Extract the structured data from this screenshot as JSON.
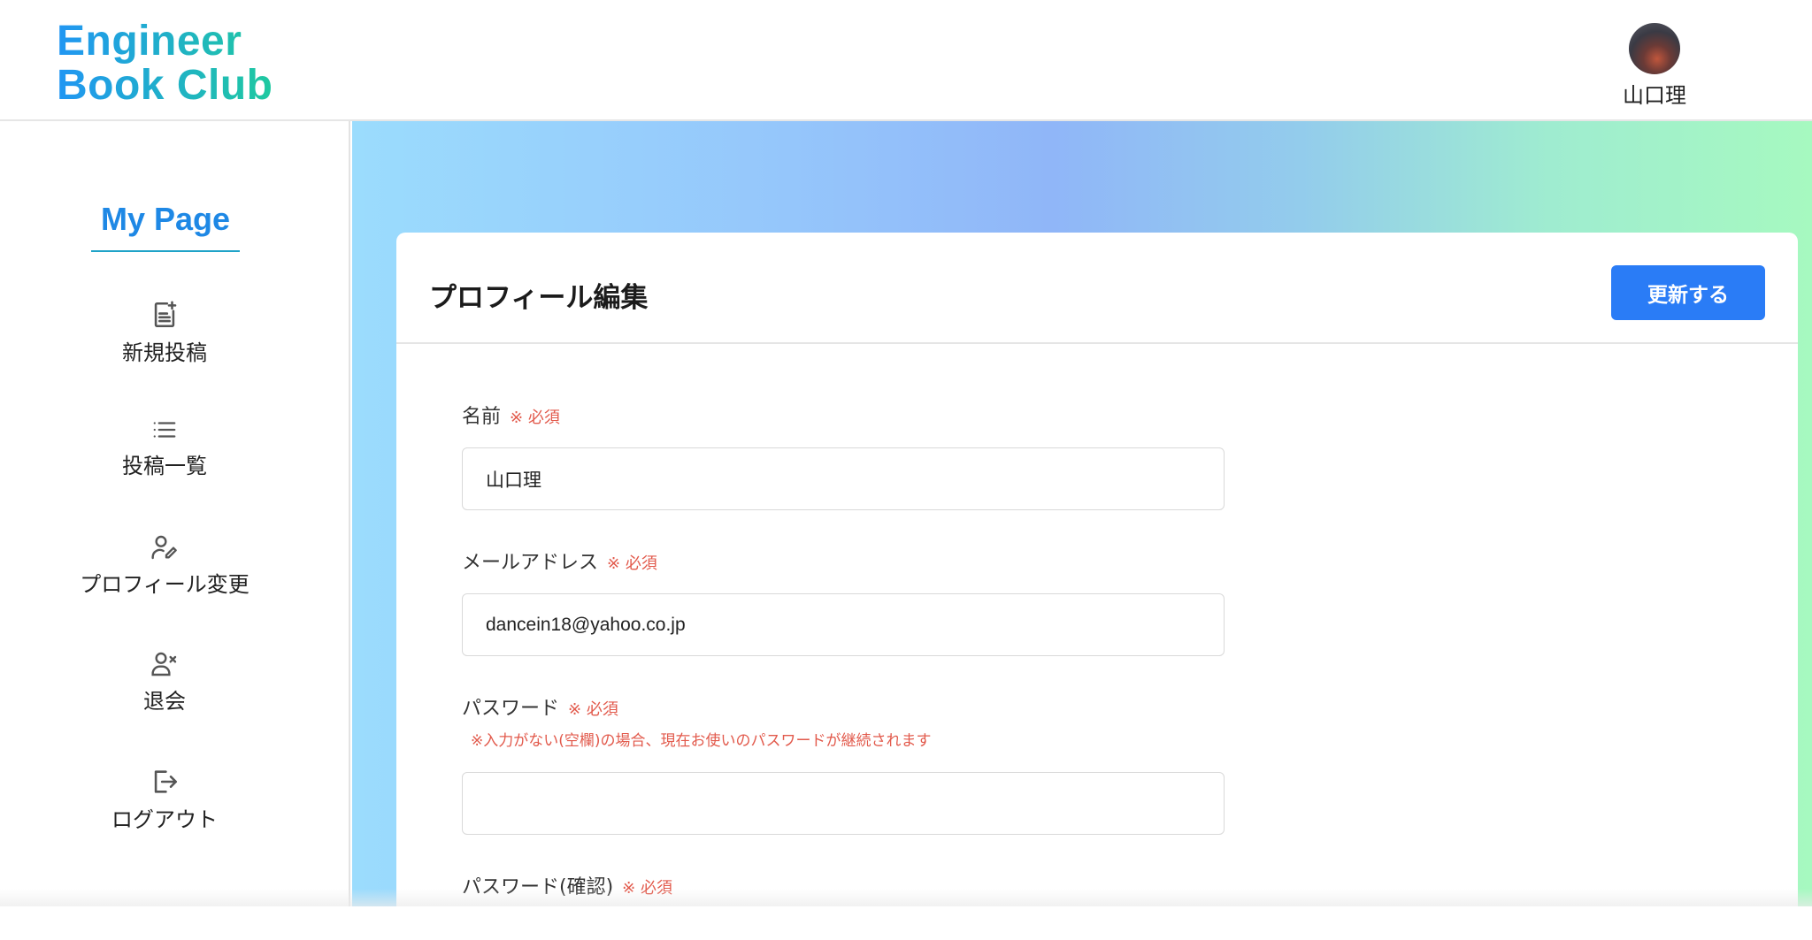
{
  "header": {
    "logo_line1": "Engineer",
    "logo_line2": "Book Club",
    "user_name": "山口理"
  },
  "sidebar": {
    "title": "My Page",
    "items": [
      {
        "label": "新規投稿",
        "icon": "new-post-icon"
      },
      {
        "label": "投稿一覧",
        "icon": "list-icon"
      },
      {
        "label": "プロフィール変更",
        "icon": "user-edit-icon"
      },
      {
        "label": "退会",
        "icon": "user-remove-icon"
      },
      {
        "label": "ログアウト",
        "icon": "logout-icon"
      }
    ]
  },
  "form": {
    "title": "プロフィール編集",
    "submit_label": "更新する",
    "required_text": "※ 必須",
    "name": {
      "label": "名前",
      "value": "山口理"
    },
    "email": {
      "label": "メールアドレス",
      "value": "dancein18@yahoo.co.jp"
    },
    "password": {
      "label": "パスワード",
      "hint": "※入力がない(空欄)の場合、現在お使いのパスワードが継続されます",
      "value": ""
    },
    "password_confirm": {
      "label": "パスワード(確認)"
    }
  },
  "colors": {
    "brand_blue": "#2196f3",
    "brand_green": "#1fc9a0",
    "button": "#2a7cf6",
    "required": "#e25a4c"
  }
}
